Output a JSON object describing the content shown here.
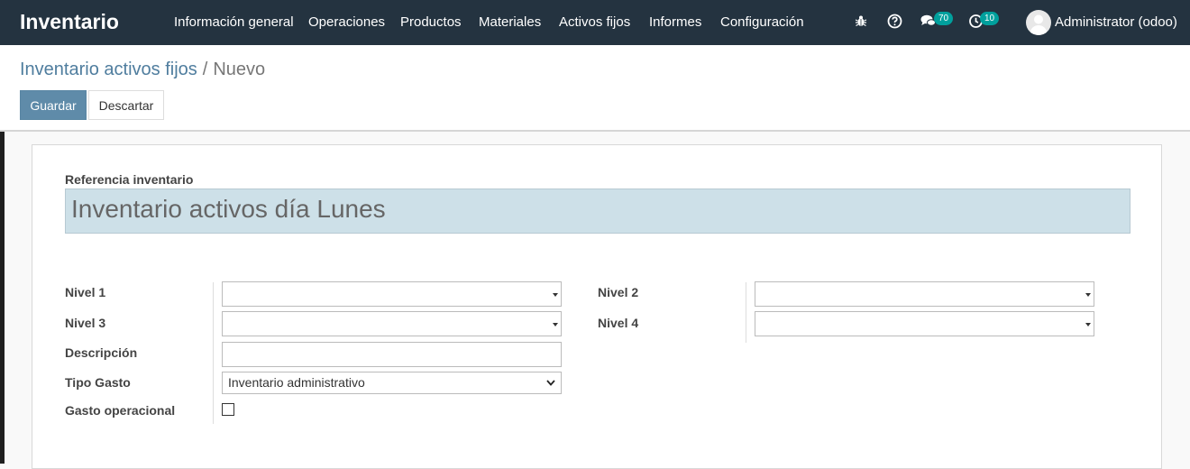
{
  "navbar": {
    "app_name": "Inventario",
    "menu": [
      "Información general",
      "Operaciones",
      "Productos",
      "Materiales",
      "Activos fijos",
      "Informes",
      "Configuración"
    ],
    "messages_count": "70",
    "activities_count": "10",
    "user": "Administrator (odoo)",
    "icons": [
      "bug-icon",
      "help-icon",
      "chat-icon",
      "clock-icon"
    ]
  },
  "breadcrumb": {
    "parent": "Inventario activos fijos",
    "separator": "/",
    "current": "Nuevo"
  },
  "buttons": {
    "save": "Guardar",
    "discard": "Descartar"
  },
  "form": {
    "reference_label": "Referencia inventario",
    "reference_value": "Inventario activos día Lunes",
    "nivel1_label": "Nivel 1",
    "nivel2_label": "Nivel 2",
    "nivel3_label": "Nivel 3",
    "nivel4_label": "Nivel 4",
    "descripcion_label": "Descripción",
    "tipo_gasto_label": "Tipo Gasto",
    "tipo_gasto_value": "Inventario administrativo",
    "gasto_operacional_label": "Gasto operacional",
    "gasto_operacional_checked": false
  },
  "colors": {
    "navbar_bg": "#243340",
    "primary": "#5f8ba9",
    "badge": "#00a09d",
    "name_field_bg": "#cde0e8"
  }
}
